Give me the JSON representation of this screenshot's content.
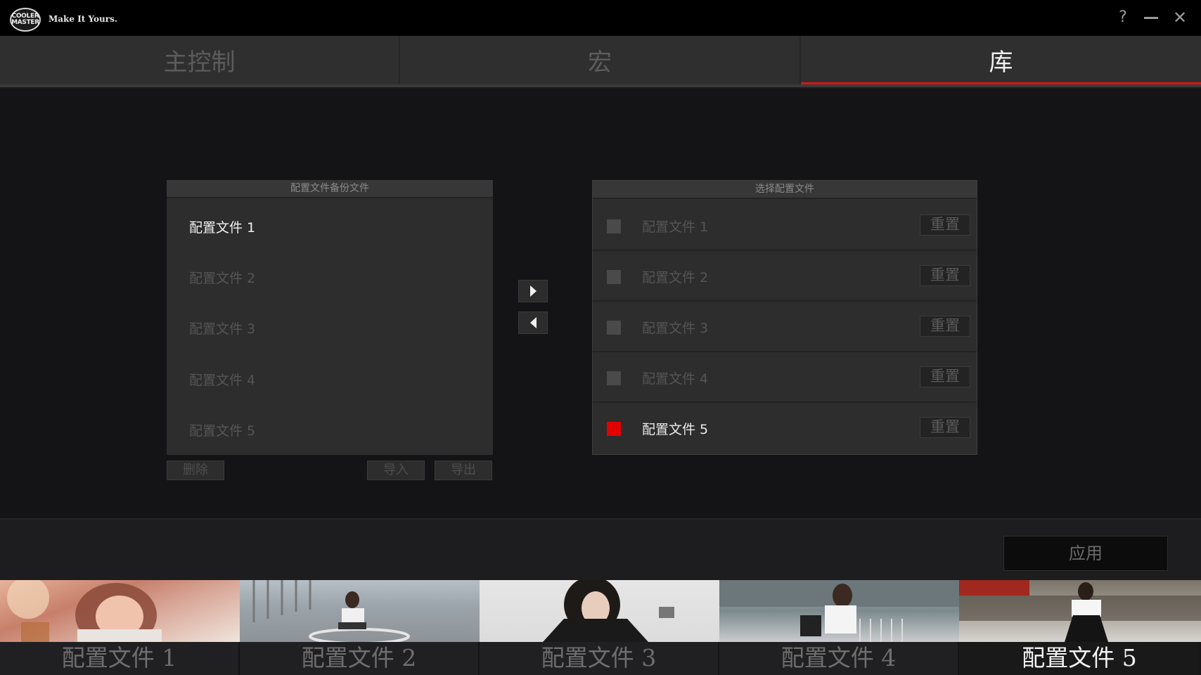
{
  "app": {
    "brand_text": "COOLER MASTER",
    "tagline": "Make It Yours.",
    "window": {
      "help_symbol": "?",
      "close_symbol": "✕"
    }
  },
  "tabs": [
    {
      "label": "主控制",
      "active": false
    },
    {
      "label": "宏",
      "active": false
    },
    {
      "label": "库",
      "active": true
    }
  ],
  "backup_panel": {
    "header": "配置文件备份文件",
    "items": [
      {
        "label": "配置文件 1",
        "selected": true
      },
      {
        "label": "配置文件 2",
        "selected": false
      },
      {
        "label": "配置文件 3",
        "selected": false
      },
      {
        "label": "配置文件 4",
        "selected": false
      },
      {
        "label": "配置文件 5",
        "selected": false
      }
    ],
    "delete_label": "删除",
    "import_label": "导入",
    "export_label": "导出"
  },
  "select_panel": {
    "header": "选择配置文件",
    "rows": [
      {
        "label": "配置文件 1",
        "checked": false,
        "reset_label": "重置"
      },
      {
        "label": "配置文件 2",
        "checked": false,
        "reset_label": "重置"
      },
      {
        "label": "配置文件 3",
        "checked": false,
        "reset_label": "重置"
      },
      {
        "label": "配置文件 4",
        "checked": false,
        "reset_label": "重置"
      },
      {
        "label": "配置文件 5",
        "checked": true,
        "reset_label": "重置"
      }
    ]
  },
  "apply_label": "应用",
  "profiles": [
    {
      "label": "配置文件 1",
      "active": false
    },
    {
      "label": "配置文件 2",
      "active": false
    },
    {
      "label": "配置文件 3",
      "active": false
    },
    {
      "label": "配置文件 4",
      "active": false
    },
    {
      "label": "配置文件 5",
      "active": true
    }
  ],
  "colors": {
    "accent": "#e30000",
    "background": "#141416",
    "panel": "#2d2d2e"
  }
}
